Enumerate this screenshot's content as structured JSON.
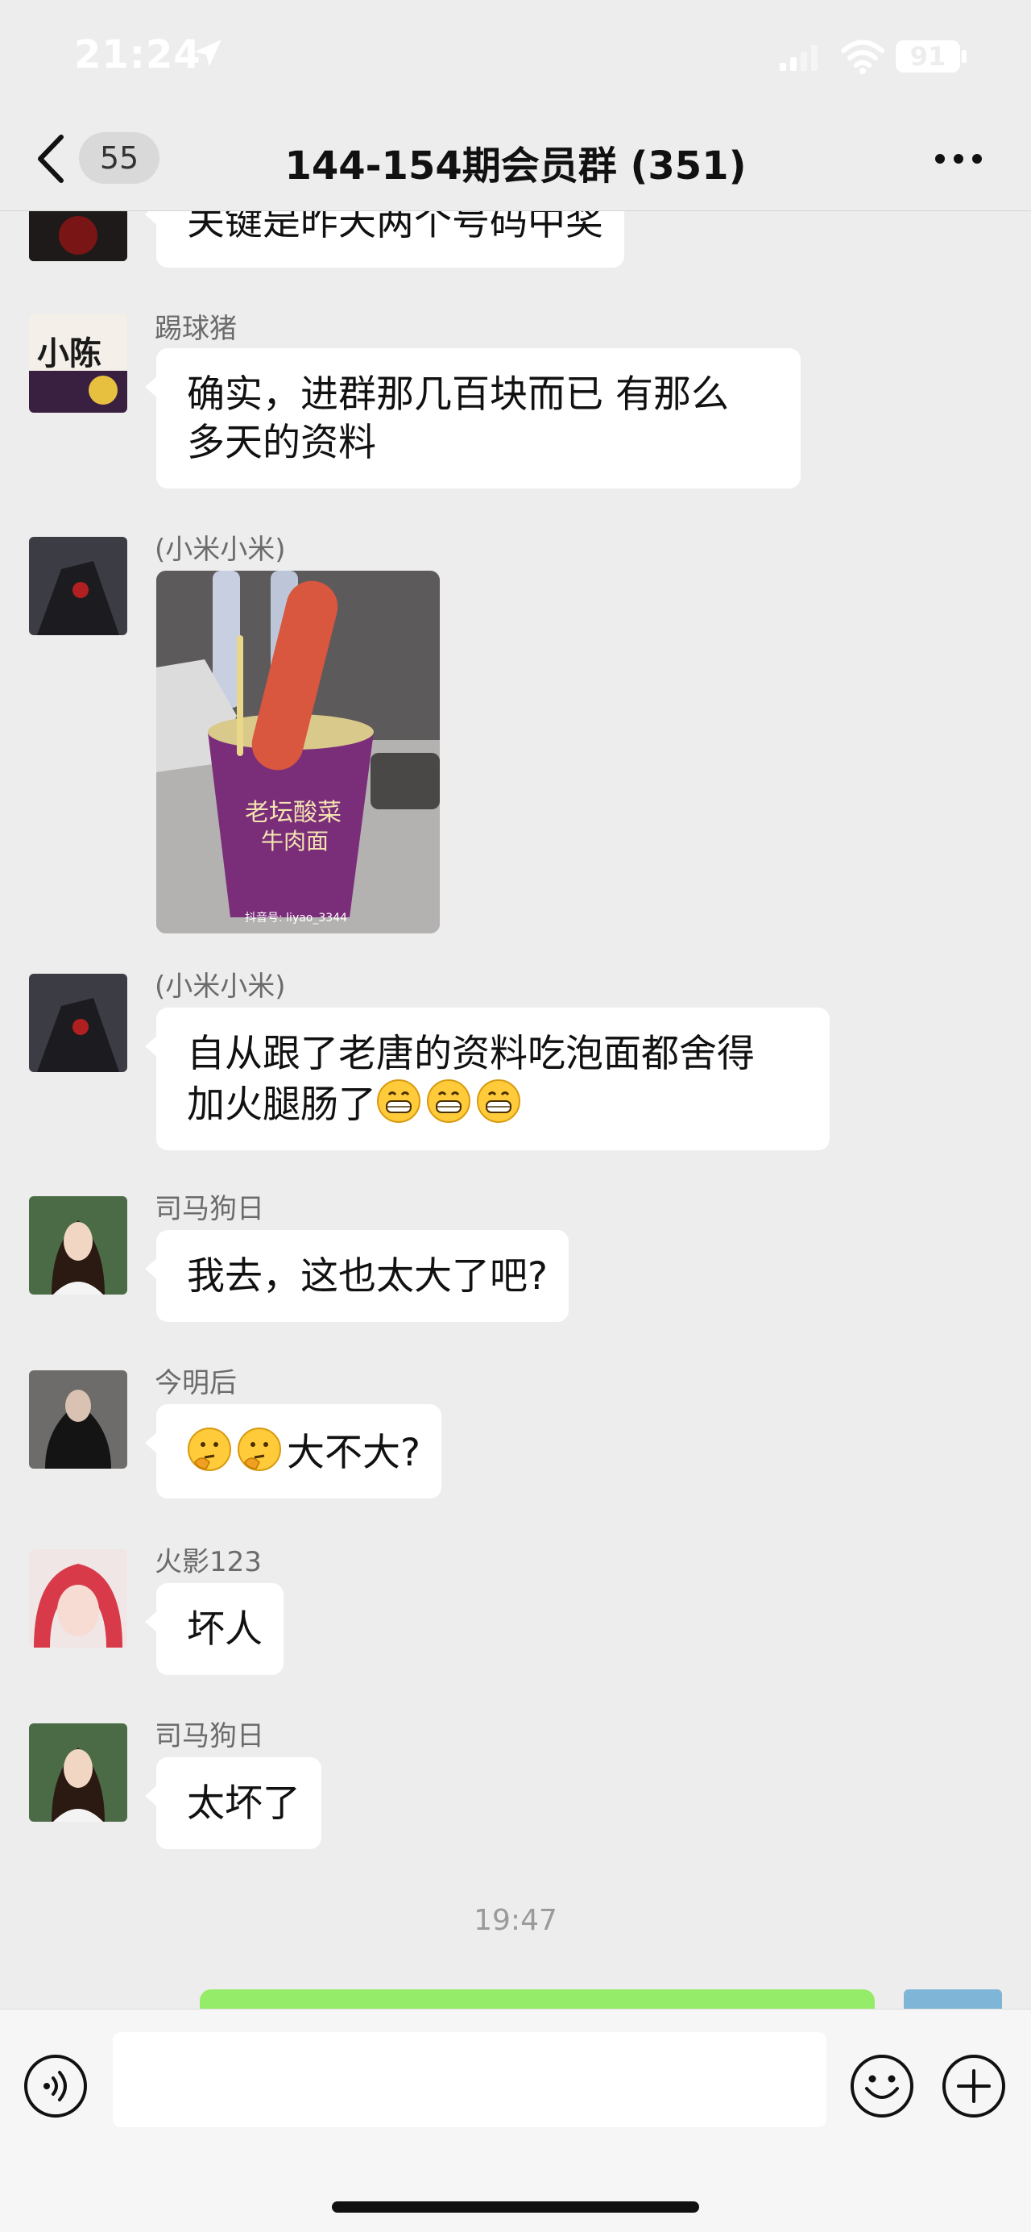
{
  "status_bar": {
    "time": "21:24",
    "battery": "91",
    "icons": [
      "location-arrow-icon",
      "signal-icon",
      "wifi-icon",
      "battery-icon"
    ]
  },
  "header": {
    "unread_count": "55",
    "title": "144-154期会员群 (351)",
    "icons": [
      "back-chevron-icon",
      "more-dots-icon"
    ]
  },
  "messages": [
    {
      "sender": "",
      "text": "关键是昨天两个号码中奖",
      "partial": true
    },
    {
      "sender": "踢球猪",
      "line1": "确实，进群那几百块而已 有那么",
      "line2": "多天的资料",
      "avatar_text": "小陈"
    },
    {
      "sender": "(小米小米)",
      "type": "image",
      "image_caption": "抖音号: liyao_3344",
      "image_desc": "方便面碗里的火腿肠"
    },
    {
      "sender": "(小米小米)",
      "line1": "自从跟了老唐的资料吃泡面都舍得",
      "line2": "加火腿肠了",
      "emojis": [
        "grin-emoji",
        "grin-emoji",
        "grin-emoji"
      ]
    },
    {
      "sender": "司马狗日",
      "text": "我去，这也太大了吧?"
    },
    {
      "sender": "今明后",
      "text": "大不大?",
      "emojis": [
        "thinking-emoji",
        "thinking-emoji"
      ]
    },
    {
      "sender": "火影123",
      "text": "坏人"
    },
    {
      "sender": "司马狗日",
      "text": "太坏了"
    }
  ],
  "timestamp": "19:47",
  "input_bar": {
    "placeholder": "",
    "icons": [
      "voice-icon",
      "emoji-icon",
      "plus-icon"
    ]
  },
  "colors": {
    "background": "#ededed",
    "bubble_in": "#ffffff",
    "bubble_out": "#95ec69",
    "sender_name": "#6b6b6b"
  }
}
